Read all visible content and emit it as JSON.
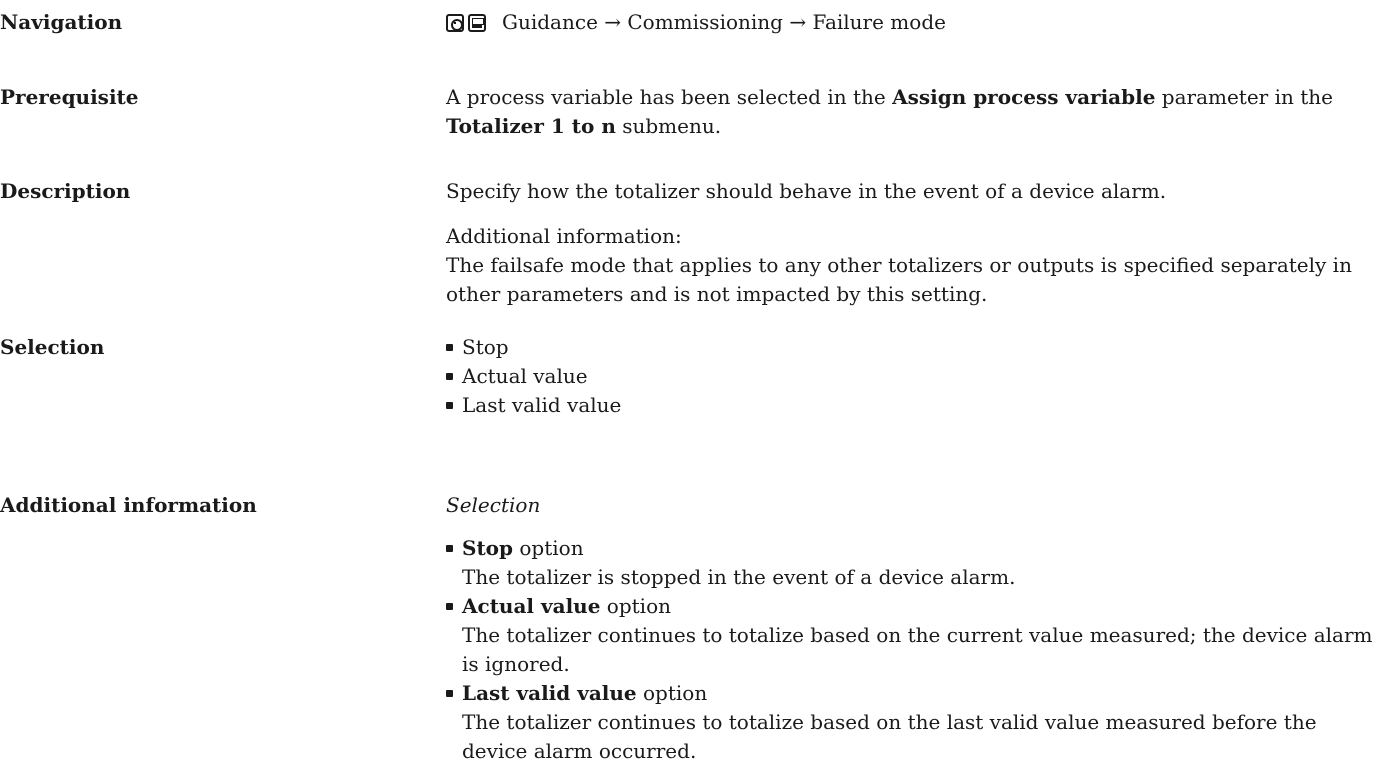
{
  "navigation": {
    "label": "Navigation",
    "icons": [
      "keypad-icon",
      "display-icon"
    ],
    "path": "Guidance → Commissioning → Failure mode"
  },
  "prerequisite": {
    "label": "Prerequisite",
    "text1": "A process variable has been selected in the ",
    "bold1": "Assign process variable",
    "text2": " parameter in the",
    "bold2": "Totalizer 1 to n",
    "text3": " submenu."
  },
  "description": {
    "label": "Description",
    "main": "Specify how the totalizer should behave in the event of a device alarm.",
    "additional_heading": "Additional information:",
    "additional_line1": "The failsafe mode that applies to any other totalizers or outputs is specified separately in",
    "additional_line2": "other parameters and is not impacted by this setting."
  },
  "selection": {
    "label": "Selection",
    "options": [
      "Stop",
      "Actual value",
      "Last valid value"
    ]
  },
  "additional_information": {
    "label": "Additional information",
    "subheading": "Selection",
    "items": [
      {
        "bold": "Stop",
        "suffix": " option",
        "lines": [
          "The totalizer is stopped in the event of a device alarm."
        ]
      },
      {
        "bold": "Actual value",
        "suffix": " option",
        "lines": [
          "The totalizer continues to totalize based on the current value measured; the device alarm",
          "is ignored."
        ]
      },
      {
        "bold": "Last valid value",
        "suffix": " option",
        "lines": [
          "The totalizer continues to totalize based on the last valid value measured before the",
          "device alarm occurred."
        ]
      }
    ]
  }
}
